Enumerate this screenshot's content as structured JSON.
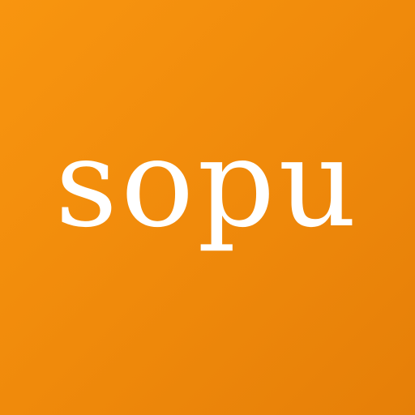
{
  "logo": {
    "wordmark": "sopu",
    "background_color_start": "#f8950f",
    "background_color_end": "#e67f08",
    "text_color": "#ffffff"
  }
}
